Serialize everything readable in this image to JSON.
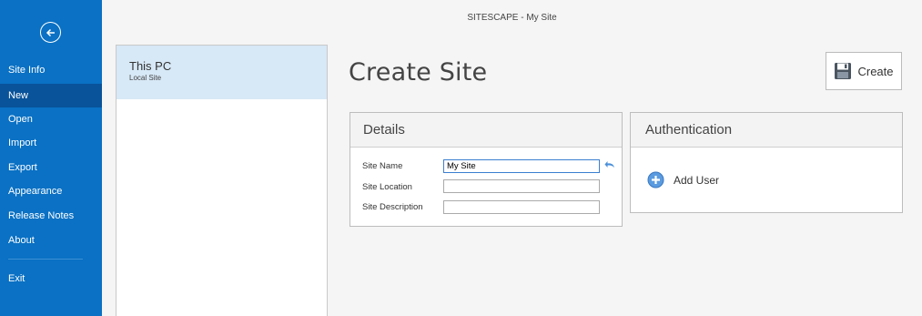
{
  "window": {
    "title": "SITESCAPE - My Site"
  },
  "nav": {
    "back_icon": "arrow-left-circle-icon",
    "items": [
      {
        "label": "Site Info"
      },
      {
        "label": "New",
        "selected": true
      },
      {
        "label": "Open"
      },
      {
        "label": "Import"
      },
      {
        "label": "Export"
      },
      {
        "label": "Appearance"
      },
      {
        "label": "Release Notes"
      },
      {
        "label": "About"
      },
      {
        "label": "Exit"
      }
    ]
  },
  "locations": {
    "items": [
      {
        "name": "This PC",
        "sub": "Local Site",
        "selected": true
      }
    ]
  },
  "main": {
    "heading": "Create Site",
    "create_button": {
      "label": "Create",
      "icon": "save-disk-icon"
    },
    "details": {
      "title": "Details",
      "fields": {
        "site_name": {
          "label": "Site Name",
          "value": "My Site"
        },
        "site_location": {
          "label": "Site Location",
          "value": ""
        },
        "site_description": {
          "label": "Site Description",
          "value": ""
        }
      },
      "undo_icon": "undo-arrow-icon"
    },
    "authentication": {
      "title": "Authentication",
      "add_user": {
        "label": "Add User",
        "icon": "plus-circle-icon"
      }
    }
  },
  "colors": {
    "nav_bg": "#0a71c4",
    "nav_selected": "#09539a",
    "location_selected": "#d7e8f6",
    "input_focus": "#3b7fd0"
  }
}
